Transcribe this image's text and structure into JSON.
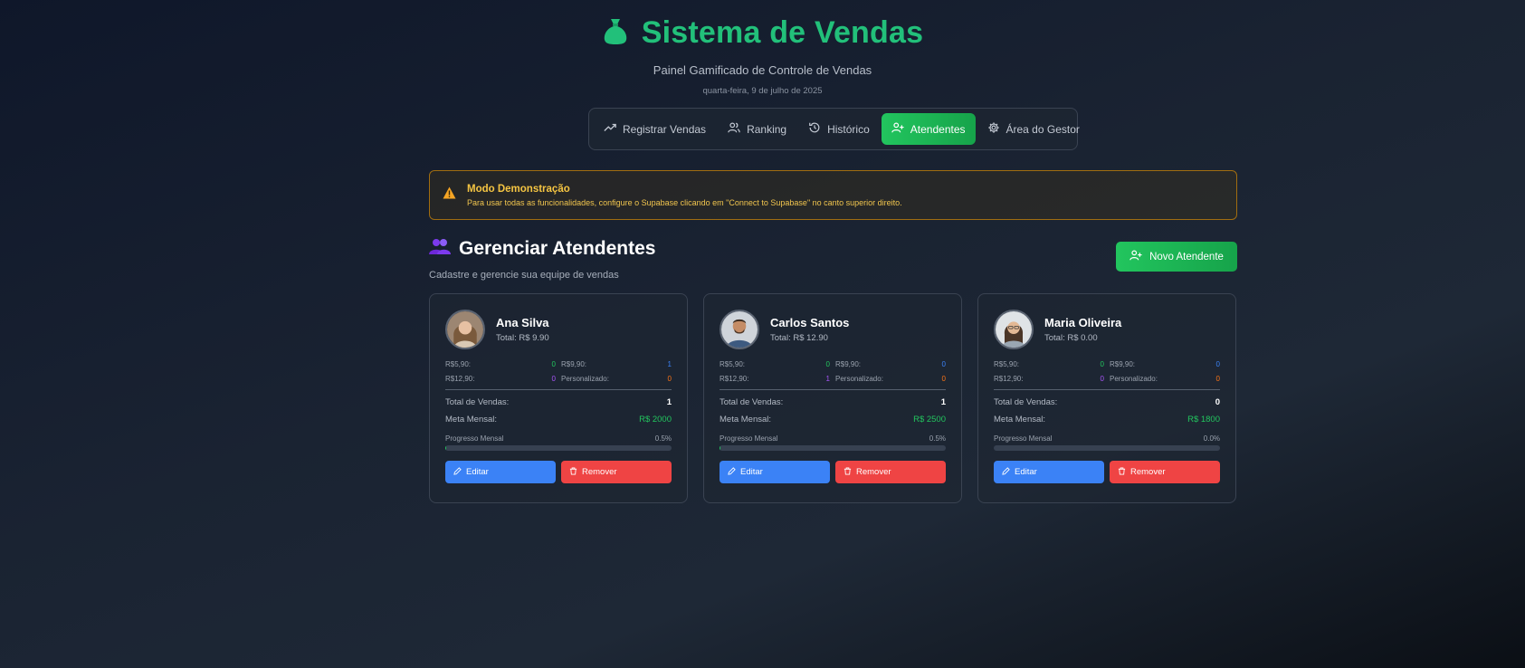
{
  "header": {
    "title": "Sistema de Vendas",
    "subtitle": "Painel Gamificado de Controle de Vendas",
    "date": "quarta-feira, 9 de julho de 2025",
    "logo_icon": "money-bag-icon",
    "brand_color": "#22c07a"
  },
  "nav": [
    {
      "label": "Registrar Vendas",
      "icon": "trending-up-icon",
      "active": false
    },
    {
      "label": "Ranking",
      "icon": "users-icon",
      "active": false
    },
    {
      "label": "Histórico",
      "icon": "history-icon",
      "active": false
    },
    {
      "label": "Atendentes",
      "icon": "user-plus-icon",
      "active": true
    },
    {
      "label": "Área do Gestor",
      "icon": "gear-icon",
      "active": false
    }
  ],
  "alert": {
    "title": "Modo Demonstração",
    "text": "Para usar todas as funcionalidades, configure o Supabase clicando em \"Connect to Supabase\" no canto superior direito.",
    "color": "#f5c542"
  },
  "section": {
    "title": "Gerenciar Atendentes",
    "subtitle": "Cadastre e gerencie sua equipe de vendas",
    "new_button": "Novo Atendente"
  },
  "labels": {
    "p590": "R$5,90:",
    "p990": "R$9,90:",
    "p1290": "R$12,90:",
    "custom": "Personalizado:",
    "total_sales": "Total de Vendas:",
    "monthly_goal": "Meta Mensal:",
    "monthly_progress": "Progresso Mensal",
    "edit": "Editar",
    "remove": "Remover"
  },
  "attendants": [
    {
      "name": "Ana Silva",
      "total": "Total: R$ 9.90",
      "p590": "0",
      "p990": "1",
      "p1290": "0",
      "custom": "0",
      "total_sales": "1",
      "goal": "R$ 2000",
      "progress_label": "0.5%",
      "progress": 0.5
    },
    {
      "name": "Carlos Santos",
      "total": "Total: R$ 12.90",
      "p590": "0",
      "p990": "0",
      "p1290": "1",
      "custom": "0",
      "total_sales": "1",
      "goal": "R$ 2500",
      "progress_label": "0.5%",
      "progress": 0.5
    },
    {
      "name": "Maria Oliveira",
      "total": "Total: R$ 0.00",
      "p590": "0",
      "p990": "0",
      "p1290": "0",
      "custom": "0",
      "total_sales": "0",
      "goal": "R$ 1800",
      "progress_label": "0.0%",
      "progress": 0.0
    }
  ]
}
